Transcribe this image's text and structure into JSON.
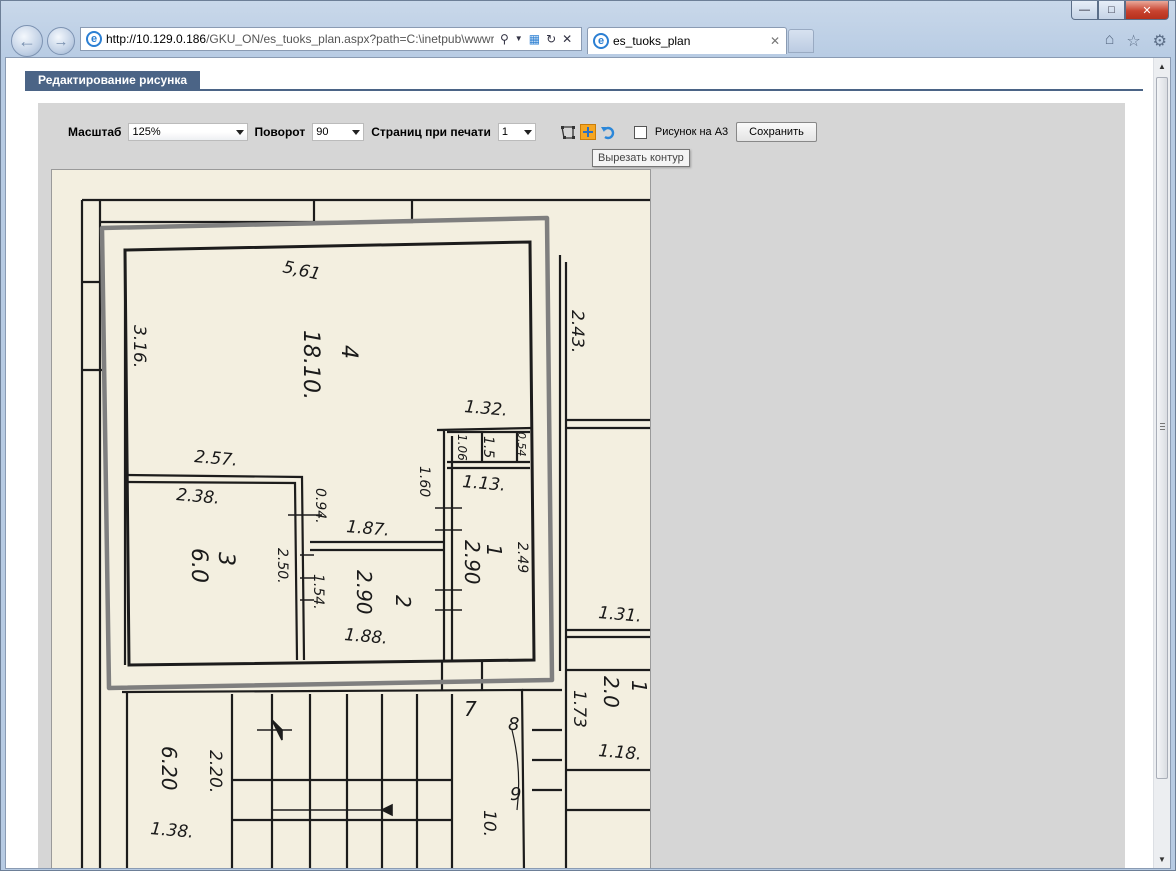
{
  "browser": {
    "url_host": "http://10.129.0.186",
    "url_rest": "/GKU_ON/es_tuoks_plan.aspx?path=C:\\inetpub\\wwwro",
    "tab_title": "es_tuoks_plan",
    "ie_glyph": "e"
  },
  "panel": {
    "title": "Редактирование рисунка"
  },
  "toolbar": {
    "scale_label": "Масштаб",
    "scale_value": "125%",
    "rotation_label": "Поворот",
    "rotation_value": "90",
    "pages_label": "Страниц при печати",
    "pages_value": "1",
    "a3_label": "Рисунок на А3",
    "a3_checked": false,
    "save_label": "Сохранить",
    "tooltip": "Вырезать контур"
  },
  "plan": {
    "labels": [
      {
        "text": "5,61",
        "rot": 12
      },
      {
        "text": "4",
        "rot": 90
      },
      {
        "text": "18.10.",
        "rot": 90
      },
      {
        "text": "3.16.",
        "rot": 90
      },
      {
        "text": "2.43.",
        "rot": 90
      },
      {
        "text": "1.32.",
        "rot": 5
      },
      {
        "text": "1.5",
        "rot": 90
      },
      {
        "text": "1.06",
        "rot": 90
      },
      {
        "text": "0.54",
        "rot": 90
      },
      {
        "text": "2.57.",
        "rot": 5
      },
      {
        "text": "1.60",
        "rot": 90
      },
      {
        "text": "1.13.",
        "rot": 5
      },
      {
        "text": "2.38.",
        "rot": 5
      },
      {
        "text": "0.94.",
        "rot": 90
      },
      {
        "text": "1.87.",
        "rot": 5
      },
      {
        "text": "3",
        "rot": 90
      },
      {
        "text": "6.0",
        "rot": 90
      },
      {
        "text": "2.50.",
        "rot": 90
      },
      {
        "text": "1",
        "rot": 90
      },
      {
        "text": "2.90",
        "rot": 90
      },
      {
        "text": "2.49",
        "rot": 90
      },
      {
        "text": "1.54.",
        "rot": 90
      },
      {
        "text": "2",
        "rot": 90
      },
      {
        "text": "2.90",
        "rot": 90
      },
      {
        "text": "1.88.",
        "rot": 5
      },
      {
        "text": "1.31.",
        "rot": 5
      },
      {
        "text": "1",
        "rot": 90
      },
      {
        "text": "2.0",
        "rot": 90
      },
      {
        "text": "1.73",
        "rot": 90
      },
      {
        "text": "1.18.",
        "rot": 5
      },
      {
        "text": "6.20",
        "rot": 90
      },
      {
        "text": "2.20.",
        "rot": 90
      },
      {
        "text": "1.38.",
        "rot": 5
      },
      {
        "text": "7",
        "rot": 0
      },
      {
        "text": "8",
        "rot": 0
      },
      {
        "text": "9",
        "rot": 0
      },
      {
        "text": "10.",
        "rot": 90
      }
    ]
  }
}
